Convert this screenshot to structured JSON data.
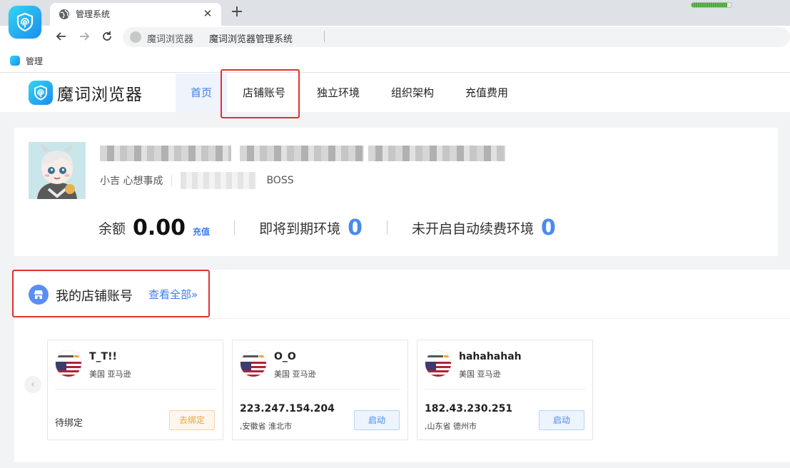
{
  "browser": {
    "tab_title": "管理系统",
    "tab_close": "✕",
    "new_tab": "+",
    "site_name": "魔词浏览器",
    "page_url": "魔词浏览器管理系统",
    "bookmark": "管理",
    "battery_level": 0.9
  },
  "header": {
    "brand": "魔词浏览器",
    "nav": [
      "首页",
      "店铺账号",
      "独立环境",
      "组织架构",
      "充值费用"
    ],
    "active_index": 0
  },
  "profile": {
    "nickname": "小吉 心想事成",
    "role": "BOSS",
    "balance_label": "余额",
    "balance_value": "0.00",
    "recharge_label": "充值",
    "expiring_label": "即将到期环境",
    "expiring_value": "0",
    "no_autorenew_label": "未开启自动续费环境",
    "no_autorenew_value": "0"
  },
  "shops": {
    "title": "我的店铺账号",
    "view_all": "查看全部»",
    "cards": [
      {
        "name": "T_T!!",
        "region": "美国 亚马逊",
        "status": "待绑定",
        "action": "去绑定"
      },
      {
        "name": "O_O",
        "region": "美国 亚马逊",
        "ip": "223.247.154.204",
        "location": ",安徽省 淮北市",
        "action": "启动"
      },
      {
        "name": "hahahahah",
        "region": "美国 亚马逊",
        "ip": "182.43.230.251",
        "location": ",山东省 德州市",
        "action": "启动"
      }
    ]
  },
  "colors": {
    "accent": "#3c7cf0",
    "highlight_box": "#e3302f",
    "warning": "#e6a23c"
  }
}
